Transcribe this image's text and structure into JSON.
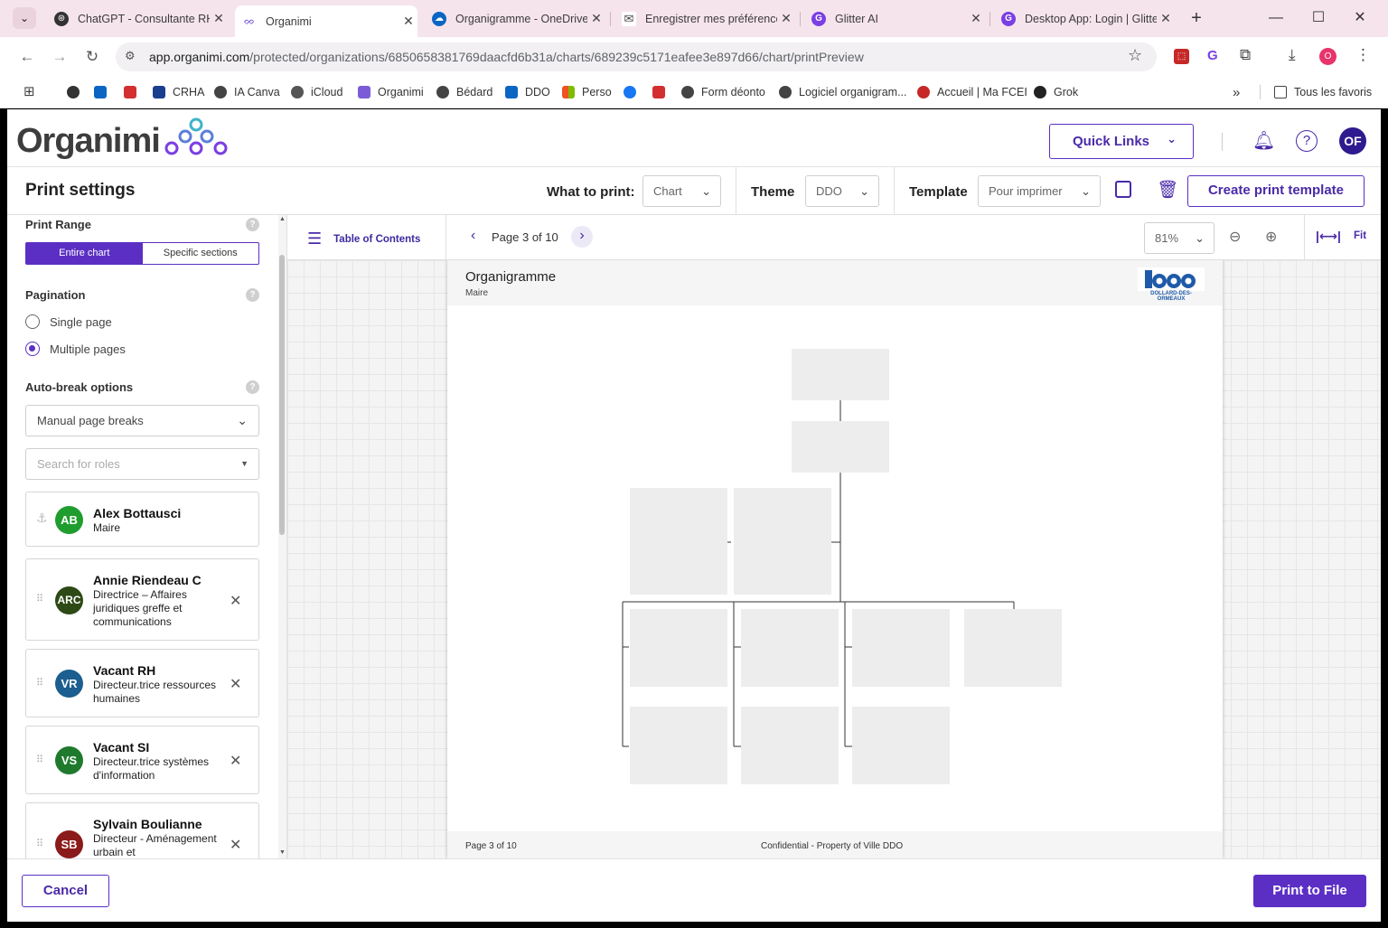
{
  "browser": {
    "tabs": [
      {
        "title": "ChatGPT - Consultante RH",
        "icon_color": "#333333",
        "active": false
      },
      {
        "title": "Organimi",
        "icon_color": "#7b5cd6",
        "active": true
      },
      {
        "title": "Organigramme - OneDrive",
        "icon_color": "#0a66c2",
        "active": false
      },
      {
        "title": "Enregistrer mes préférences",
        "icon_color": "#555555",
        "active": false
      },
      {
        "title": "Glitter AI",
        "icon_color": "#7a3fe4",
        "active": false
      },
      {
        "title": "Desktop App: Login | Glitter",
        "icon_color": "#7a3fe4",
        "active": false
      }
    ],
    "new_tab": "+",
    "url_host": "app.organimi.com",
    "url_path": "/protected/organizations/6850658381769daacfd6b31a/charts/689239c5171eafee3e897d66/chart/printPreview",
    "profile_initial": "O",
    "bookmarks": [
      {
        "label": "",
        "color": "#333333"
      },
      {
        "label": "",
        "color": "#0a66c2"
      },
      {
        "label": "",
        "color": "#d32f2f"
      },
      {
        "label": "CRHA",
        "color": "#1a3f8f"
      },
      {
        "label": "IA Canva",
        "color": "#444444"
      },
      {
        "label": "iCloud",
        "color": "#555555"
      },
      {
        "label": "Organimi",
        "color": "#7b5cd6"
      },
      {
        "label": "Bédard",
        "color": "#444444"
      },
      {
        "label": "DDO",
        "color": "#0a66c2"
      },
      {
        "label": "Perso",
        "color": "#f25022"
      },
      {
        "label": "",
        "color": "#1877f2"
      },
      {
        "label": "",
        "color": "#d32f2f"
      },
      {
        "label": "Form déonto",
        "color": "#444444"
      },
      {
        "label": "Logiciel organigram...",
        "color": "#444444"
      },
      {
        "label": "Accueil | Ma FCEI",
        "color": "#c62828"
      },
      {
        "label": "Grok",
        "color": "#222222"
      }
    ],
    "more": "»",
    "all_bookmarks": "Tous les favoris"
  },
  "app": {
    "logo": "Organimi",
    "quick_links": "Quick Links",
    "avatar": "OF",
    "print_settings_title": "Print settings",
    "what_to_print_label": "What to print:",
    "what_to_print_value": "Chart",
    "theme_label": "Theme",
    "theme_value": "DDO",
    "template_label": "Template",
    "template_value": "Pour imprimer",
    "create_template": "Create print template"
  },
  "left_panel": {
    "print_range_title": "Print Range",
    "range_entire": "Entire chart",
    "range_specific": "Specific sections",
    "pagination_title": "Pagination",
    "single_page": "Single page",
    "multiple_pages": "Multiple pages",
    "auto_break_title": "Auto-break options",
    "auto_break_value": "Manual page breaks",
    "search_placeholder": "Search for roles",
    "roles": [
      {
        "initials": "AB",
        "name": "Alex Bottausci",
        "title": "Maire",
        "color": "#1f9d2e"
      },
      {
        "initials": "ARC",
        "name": "Annie Riendeau C",
        "title": "Directrice – Affaires juridiques greffe et communications",
        "color": "#2d4a16"
      },
      {
        "initials": "VR",
        "name": "Vacant RH",
        "title": "Directeur.trice ressources humaines",
        "color": "#1b5e8f"
      },
      {
        "initials": "VS",
        "name": "Vacant SI",
        "title": "Directeur.trice systèmes d'information",
        "color": "#1f7a2e"
      },
      {
        "initials": "SB",
        "name": "Sylvain Boulianne",
        "title": "Directeur - Aménagement urbain et",
        "color": "#8b1a1a"
      }
    ]
  },
  "preview": {
    "toc": "Table of Contents",
    "page_indicator": "Page 3 of 10",
    "zoom": "81%",
    "fit": "Fit",
    "page_title": "Organigramme",
    "page_subtitle": "Maire",
    "logo_text": "DOLLARD-DES-ORMEAUX",
    "footer_page": "Page 3 of 10",
    "footer_confidential": "Confidential - Property of Ville DDO"
  },
  "footer": {
    "cancel": "Cancel",
    "print": "Print to File"
  },
  "colors": {
    "accent": "#5b2fc4",
    "tabbar_bg": "#f6e4ec"
  }
}
